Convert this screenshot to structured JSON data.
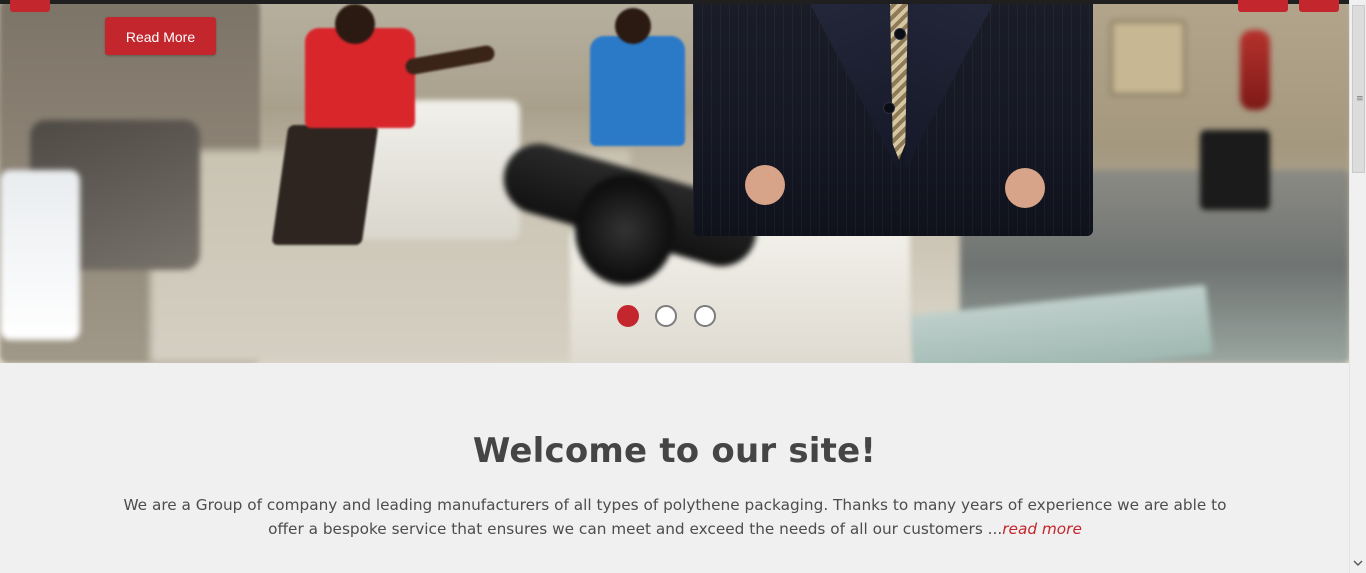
{
  "hero": {
    "read_more_label": "Read More",
    "slider": {
      "active_index": 0,
      "dot_count": 3
    },
    "colors": {
      "accent": "#c3262d",
      "dot_inactive": "#ffffff"
    }
  },
  "welcome": {
    "title": "Welcome to our site!",
    "text": "We are a Group of company and leading manufacturers of all types of polythene packaging. Thanks to many years of experience we are able to offer a bespoke service that ensures we can meet and exceed the needs of all our customers ...",
    "read_more_label": "read more"
  },
  "scrollbar": {
    "grip_icon": "grip-lines-icon",
    "arrow_icon": "chevron-down-icon"
  }
}
